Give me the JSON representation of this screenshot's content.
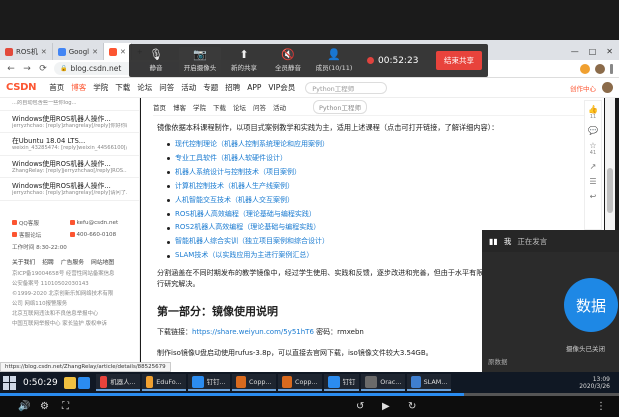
{
  "browser": {
    "tabs": [
      {
        "label": "ROS机",
        "color": "#e24a3b",
        "active": false
      },
      {
        "label": "Googl",
        "color": "#4285f4",
        "active": false
      },
      {
        "label": "",
        "color": "#fc5531",
        "active": true
      }
    ],
    "new_tab": "+",
    "window_controls": {
      "min": "—",
      "max": "□",
      "close": "✕"
    },
    "url": "blog.csdn.net",
    "status_url": "https://blog.csdn.net/ZhangRelay/article/details/88525679"
  },
  "meeting": {
    "tools": [
      {
        "label": "静音",
        "icon": "mic-icon"
      },
      {
        "label": "开启摄像头",
        "icon": "camera-icon"
      },
      {
        "label": "新的共享",
        "icon": "share-icon"
      },
      {
        "label": "全员静音",
        "icon": "mute-all-icon"
      },
      {
        "label": "成员(10/11)",
        "icon": "members-icon"
      }
    ],
    "time": "00:52:23",
    "end_share": "结束共享"
  },
  "csdn": {
    "logo": "CSDN",
    "nav": [
      "首页",
      "博客",
      "学院",
      "下载",
      "论坛",
      "问答",
      "活动",
      "专题",
      "招聘",
      "APP",
      "VIP会员"
    ],
    "active_nav": "博客",
    "search_placeholder": "Python工程师",
    "creator": "创作中心"
  },
  "sidebar": {
    "recent_comments": [
      {
        "title": "",
        "comment": "...的自动包含些一些你log..."
      },
      {
        "title": "Windows使用ROS机器人操作...",
        "comment": "jerryzhchao: [reply]zhangrelay[/reply]你好你的ROS安装配置... 还没..."
      },
      {
        "title": "在Ubuntu 18.04 LTS...",
        "comment": "weixin_43285474: [reply]weixin_44566100[/reply]ROS2..."
      },
      {
        "title": "Windows使用ROS机器人操作...",
        "comment": "ZhangRelay: [reply]jerryzhchao[/reply]ROS..."
      },
      {
        "title": "Windows使用ROS机器人操作...",
        "comment": "jerryzhchao: [reply]zhangrelay[/reply]请问了..."
      }
    ],
    "contact": {
      "qq": "QQ客服",
      "email": "kefu@csdn.net",
      "service": "客服论坛",
      "phone": "400-660-0108",
      "hours": "工作时间 8:30-22:00"
    },
    "links": [
      "关于我们",
      "招聘",
      "广告服务",
      "网站地图"
    ],
    "legal": [
      "京ICP备19004658号  经营性网站备案信息",
      "公安备案号 11010502030143",
      "©1999-2020 北京创新乐知网络技术有限",
      "公司  网络110报警服务",
      "北京互联网违法和不良信息举报中心",
      "中国互联网举报中心  家长监护  版权申诉"
    ]
  },
  "article": {
    "top_nav": [
      "首页",
      "博客",
      "学院",
      "下载",
      "论坛",
      "问答",
      "活动"
    ],
    "intro": "镜像依据本科课程制作，以项目式案例教学和实践为主，适用上述课程（点击可打开链接，了解详细内容）：",
    "courses": [
      "现代控制理论（机器人控制系统理论和应用案例）",
      "专业工具软件（机器人软硬件设计）",
      "机器人系统设计与控制技术（项目案例）",
      "计算机控制技术（机器人生产线案例）",
      "人机智能交互技术（机器人交互案例）",
      "ROS机器人高效编程（理论基础与编程实践）",
      "ROS2机器人高效编程（理论基础与编程实践）",
      "智能机器人综合实训（独立项目案例和综合设计）",
      "SLAM技术（以实践应用为主进行案例汇总）"
    ],
    "description": "分割涵盖在不同时期发布的教学镜像中，经过学生使用、实践和反馈，逐步改进和完善，但由于水平有限时间，错误和疏漏在所难免，可自行研究解决。",
    "section_title": "第一部分：镜像使用说明",
    "download_label": "下载链接：",
    "download_link": "https://share.weiyun.com/5y51hT6",
    "password_label": "密码：",
    "password": "rmxebn",
    "make_text": "制作iso镜像U盘启动使用rufus-3.8p，可以直接去官网下载，iso镜像文件较大3.54GB。"
  },
  "actions": [
    {
      "icon": "like-icon",
      "count": "11"
    },
    {
      "icon": "comment-icon",
      "count": ""
    },
    {
      "icon": "collect-icon",
      "count": "41"
    },
    {
      "icon": "share-icon",
      "count": ""
    },
    {
      "icon": "list-icon",
      "count": ""
    },
    {
      "icon": "back-icon",
      "count": ""
    }
  ],
  "participant": {
    "name": "我",
    "status": "正在发言",
    "avatar_text": "数据",
    "camera_status": "摄像头已关闭",
    "bottom_text": "原数据"
  },
  "taskbar": {
    "time": "0:50:29",
    "apps": [
      {
        "label": "机器人...",
        "color": "#e8433c"
      },
      {
        "label": "EduFo...",
        "color": "#f0a030"
      },
      {
        "label": "钉钉...",
        "color": "#2b8cf0"
      },
      {
        "label": "Copp...",
        "color": "#d96a1e"
      },
      {
        "label": "Copp...",
        "color": "#d96a1e"
      },
      {
        "label": "钉钉",
        "color": "#2b8cf0"
      },
      {
        "label": "Orac...",
        "color": "#6a6a6a"
      },
      {
        "label": "SLAM...",
        "color": "#3f7fd0"
      }
    ],
    "tray_time": "13:09",
    "tray_date": "2020/3/26"
  },
  "player": {
    "progress": 0.75
  },
  "colors": {
    "brand": "#fc5531",
    "link": "#1a7bd1",
    "end_share": "#e8433c",
    "avatar": "#1e88e5"
  }
}
